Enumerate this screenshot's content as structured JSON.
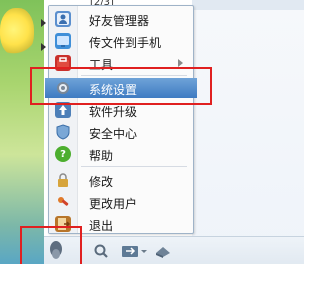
{
  "top_partial_text": "[2/3]",
  "menu": {
    "items": [
      {
        "label": "好友管理器",
        "icon": "friends-manager-icon",
        "submenu": false
      },
      {
        "label": "传文件到手机",
        "icon": "send-to-phone-icon",
        "submenu": false
      },
      {
        "label": "工具",
        "icon": "toolbox-icon",
        "submenu": true
      },
      {
        "label": "系统设置",
        "icon": "gear-icon",
        "submenu": false,
        "selected": true
      },
      {
        "label": "软件升级",
        "icon": "upgrade-icon",
        "submenu": false
      },
      {
        "label": "安全中心",
        "icon": "shield-icon",
        "submenu": false
      },
      {
        "label": "帮助",
        "icon": "help-icon",
        "submenu": false
      },
      {
        "label": "修改",
        "icon": "lock-icon",
        "submenu": false
      },
      {
        "label": "更改用户",
        "icon": "switch-user-icon",
        "submenu": false
      },
      {
        "label": "退出",
        "icon": "exit-icon",
        "submenu": false
      }
    ]
  },
  "colors": {
    "selection": "#3e7bc2",
    "highlight_box": "#e02020"
  },
  "bottombar": {
    "icons": [
      "qq-penguin-icon",
      "search-icon",
      "transfer-icon",
      "app-box-icon"
    ]
  }
}
